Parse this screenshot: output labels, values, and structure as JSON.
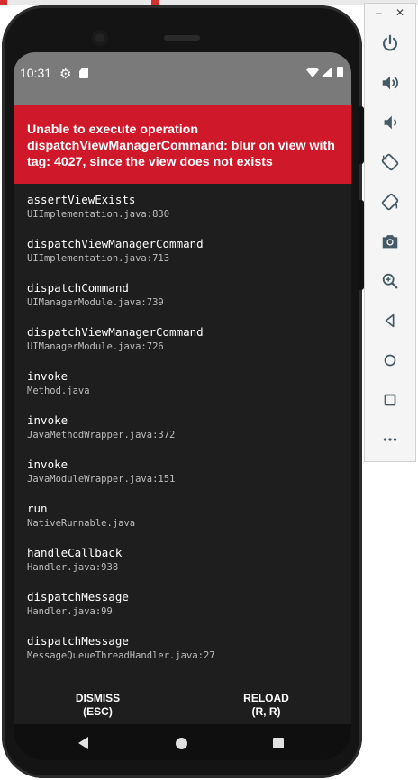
{
  "status_bar": {
    "time": "10:31"
  },
  "error": {
    "message": "Unable to execute operation dispatchViewManagerCommand: blur on view with tag: 4027, since the view does not exists"
  },
  "stack_frames": [
    {
      "method": "assertViewExists",
      "file": "UIImplementation.java:830"
    },
    {
      "method": "dispatchViewManagerCommand",
      "file": "UIImplementation.java:713"
    },
    {
      "method": "dispatchCommand",
      "file": "UIManagerModule.java:739"
    },
    {
      "method": "dispatchViewManagerCommand",
      "file": "UIManagerModule.java:726"
    },
    {
      "method": "invoke",
      "file": "Method.java"
    },
    {
      "method": "invoke",
      "file": "JavaMethodWrapper.java:372"
    },
    {
      "method": "invoke",
      "file": "JavaModuleWrapper.java:151"
    },
    {
      "method": "run",
      "file": "NativeRunnable.java"
    },
    {
      "method": "handleCallback",
      "file": "Handler.java:938"
    },
    {
      "method": "dispatchMessage",
      "file": "Handler.java:99"
    },
    {
      "method": "dispatchMessage",
      "file": "MessageQueueThreadHandler.java:27"
    }
  ],
  "actions": {
    "dismiss_label": "DISMISS",
    "dismiss_shortcut": "(ESC)",
    "reload_label": "RELOAD",
    "reload_shortcut": "(R, R)"
  },
  "emulator_toolbar": {
    "minimize_label": "–",
    "close_label": "✕",
    "buttons": [
      {
        "name": "power-icon"
      },
      {
        "name": "volume-up-icon"
      },
      {
        "name": "volume-down-icon"
      },
      {
        "name": "rotate-left-icon"
      },
      {
        "name": "rotate-right-icon"
      },
      {
        "name": "camera-icon"
      },
      {
        "name": "zoom-icon"
      },
      {
        "name": "back-icon"
      },
      {
        "name": "home-icon"
      },
      {
        "name": "overview-icon"
      },
      {
        "name": "more-icon"
      }
    ]
  },
  "colors": {
    "error_red": "#d0182b",
    "status_gray": "#7a7a7a",
    "screen_bg": "#1e1e1e"
  }
}
